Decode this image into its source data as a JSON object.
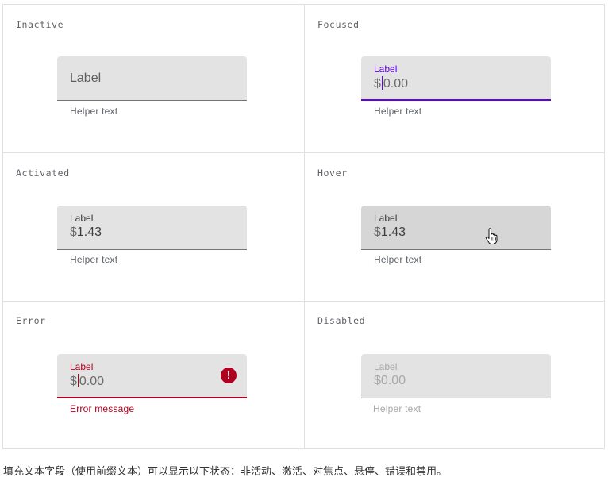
{
  "colors": {
    "focus": "#6200ee",
    "error": "#b00020",
    "disabled": "#a8a8a8",
    "field_bg": "#e3e3e3"
  },
  "states": {
    "inactive": {
      "title": "Inactive",
      "label": "Label",
      "helper": "Helper text"
    },
    "focused": {
      "title": "Focused",
      "label": "Label",
      "prefix": "$",
      "value": "0.00",
      "helper": "Helper text"
    },
    "activated": {
      "title": "Activated",
      "label": "Label",
      "prefix": "$",
      "value": "1.43",
      "helper": "Helper text"
    },
    "hover": {
      "title": "Hover",
      "label": "Label",
      "prefix": "$",
      "value": "1.43",
      "helper": "Helper text",
      "cursor_icon": "hand-pointer-icon"
    },
    "error": {
      "title": "Error",
      "label": "Label",
      "prefix": "$",
      "value": "0.00",
      "helper": "Error message",
      "icon": "error-icon",
      "icon_glyph": "!"
    },
    "disabled": {
      "title": "Disabled",
      "label": "Label",
      "prefix": "$",
      "value": "0.00",
      "helper": "Helper text"
    }
  },
  "caption": "填充文本字段（使用前缀文本）可以显示以下状态：非活动、激活、对焦点、悬停、错误和禁用。"
}
